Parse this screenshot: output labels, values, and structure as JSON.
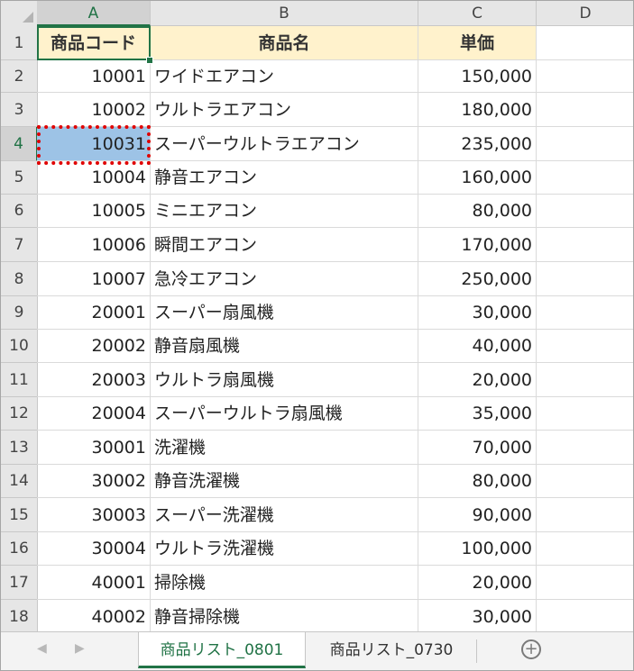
{
  "columns": [
    "A",
    "B",
    "C",
    "D"
  ],
  "header_row": {
    "row_number": "1",
    "A": "商品コード",
    "B": "商品名",
    "C": "単価"
  },
  "rows": [
    {
      "row": "2",
      "code": "10001",
      "name": "ワイドエアコン",
      "price": "150,000"
    },
    {
      "row": "3",
      "code": "10002",
      "name": "ウルトラエアコン",
      "price": "180,000"
    },
    {
      "row": "4",
      "code": "10031",
      "name": "スーパーウルトラエアコン",
      "price": "235,000"
    },
    {
      "row": "5",
      "code": "10004",
      "name": "静音エアコン",
      "price": "160,000"
    },
    {
      "row": "6",
      "code": "10005",
      "name": "ミニエアコン",
      "price": "80,000"
    },
    {
      "row": "7",
      "code": "10006",
      "name": "瞬間エアコン",
      "price": "170,000"
    },
    {
      "row": "8",
      "code": "10007",
      "name": "急冷エアコン",
      "price": "250,000"
    },
    {
      "row": "9",
      "code": "20001",
      "name": "スーパー扇風機",
      "price": "30,000"
    },
    {
      "row": "10",
      "code": "20002",
      "name": "静音扇風機",
      "price": "40,000"
    },
    {
      "row": "11",
      "code": "20003",
      "name": "ウルトラ扇風機",
      "price": "20,000"
    },
    {
      "row": "12",
      "code": "20004",
      "name": "スーパーウルトラ扇風機",
      "price": "35,000"
    },
    {
      "row": "13",
      "code": "30001",
      "name": "洗濯機",
      "price": "70,000"
    },
    {
      "row": "14",
      "code": "30002",
      "name": "静音洗濯機",
      "price": "80,000"
    },
    {
      "row": "15",
      "code": "30003",
      "name": "スーパー洗濯機",
      "price": "90,000"
    },
    {
      "row": "16",
      "code": "30004",
      "name": "ウルトラ洗濯機",
      "price": "100,000"
    },
    {
      "row": "17",
      "code": "40001",
      "name": "掃除機",
      "price": "20,000"
    },
    {
      "row": "18",
      "code": "40002",
      "name": "静音掃除機",
      "price": "30,000"
    }
  ],
  "sheet_tabs": [
    {
      "label": "商品リスト_0801",
      "active": true
    },
    {
      "label": "商品リスト_0730",
      "active": false
    }
  ],
  "add_sheet_glyph": "+",
  "colors": {
    "accent": "#217346",
    "header_fill": "#fff2cc",
    "selection_fill": "#9dc3e6",
    "marquee": "#e00000"
  }
}
